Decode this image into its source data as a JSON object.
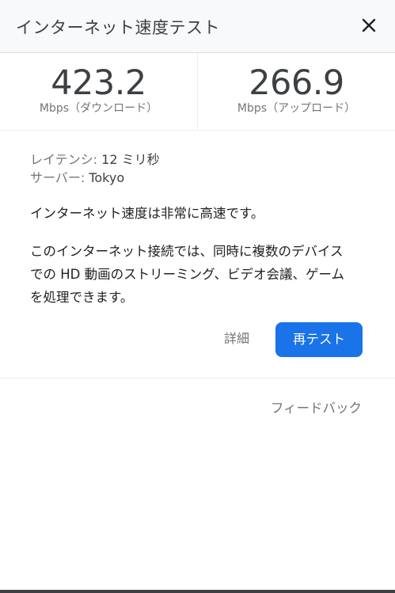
{
  "header": {
    "title": "インターネット速度テスト",
    "close_icon": "close-icon"
  },
  "download": {
    "value": "423.2",
    "unit": "Mbps（ダウンロード）"
  },
  "upload": {
    "value": "266.9",
    "unit": "Mbps（アップロード）"
  },
  "info": {
    "latency_label": "レイテンシ:",
    "latency_value": "12 ミリ秒",
    "server_label": "サーバー:",
    "server_value": "Tokyo"
  },
  "status": "インターネット速度は非常に高速です。",
  "description": {
    "lines": [
      "このインターネット接続では、同時に複数のデバイス",
      "での HD 動画のストリーミング、ビデオ会議、ゲーム",
      "を処理できます。"
    ]
  },
  "actions": {
    "details_label": "詳細",
    "retest_label": "再テスト"
  },
  "footer": {
    "feedback_label": "フィードバック"
  },
  "colors": {
    "accent": "#1a73e8",
    "header_bg": "#f8f9fa",
    "text_primary": "#202124",
    "text_secondary": "#70757a"
  }
}
